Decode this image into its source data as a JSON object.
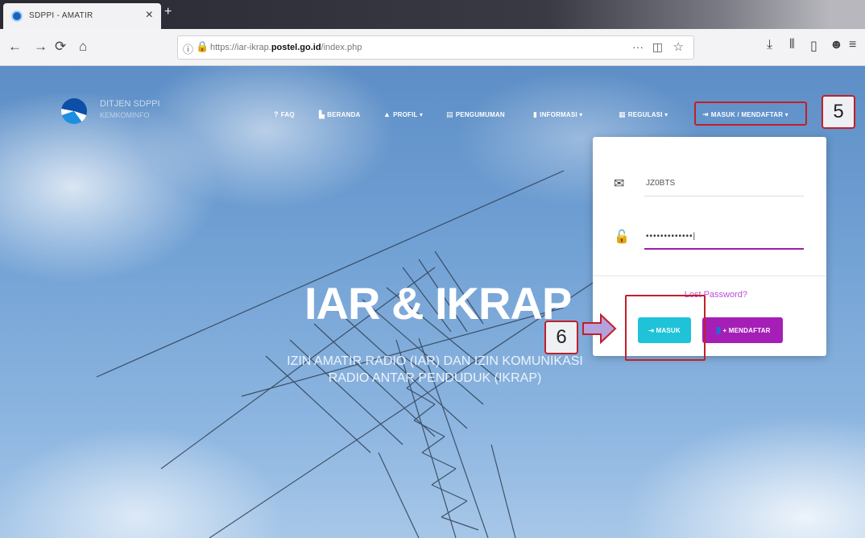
{
  "browser": {
    "tab_title": "SDPPI - AMATIR",
    "tab_close": "×",
    "new_tab": "+",
    "url_prefix": "https://iar-ikrap.",
    "url_domain": "postel.go.id",
    "url_suffix": "/index.php",
    "nav": {
      "back": "←",
      "forward": "→",
      "reload": "⟳",
      "home": "⌂"
    },
    "url_actions": {
      "more": "···",
      "pocket": "◫",
      "star": "☆"
    },
    "toolbar": {
      "download": "⤓",
      "library": "⫴",
      "sidebar": "▯",
      "addon": "☻",
      "menu": "≡"
    }
  },
  "site": {
    "logo_title": "DITJEN SDPPI",
    "logo_sub": "KEMKOMINFO",
    "menu": {
      "faq": "FAQ",
      "beranda": "BERANDA",
      "profil": "PROFIL ▾",
      "pengumuman": "PENGUMUMAN",
      "informasi": "INFORMASI ▾",
      "regulasi": "REGULASI ▾",
      "login": "MASUK / MENDAFTAR ▾"
    },
    "hero_title": "IAR & IKRAP",
    "hero_subtitle": "IZIN AMATIR RADIO (IAR) DAN IZIN KOMUNIKASI RADIO ANTAR PENDUDUK (IKRAP)"
  },
  "login": {
    "username_value": "JZ0BTS",
    "password_value": "•••••••••••••|",
    "lost_password": "Lost Password?",
    "masuk_label": "⇥ MASUK",
    "daftar_label": "👤+ MENDAFTAR"
  },
  "callouts": {
    "step5": "5",
    "step6": "6"
  },
  "colors": {
    "accent_cyan": "#1fc3d8",
    "accent_purple": "#a51fb7",
    "callout_red": "#c21f2a"
  }
}
